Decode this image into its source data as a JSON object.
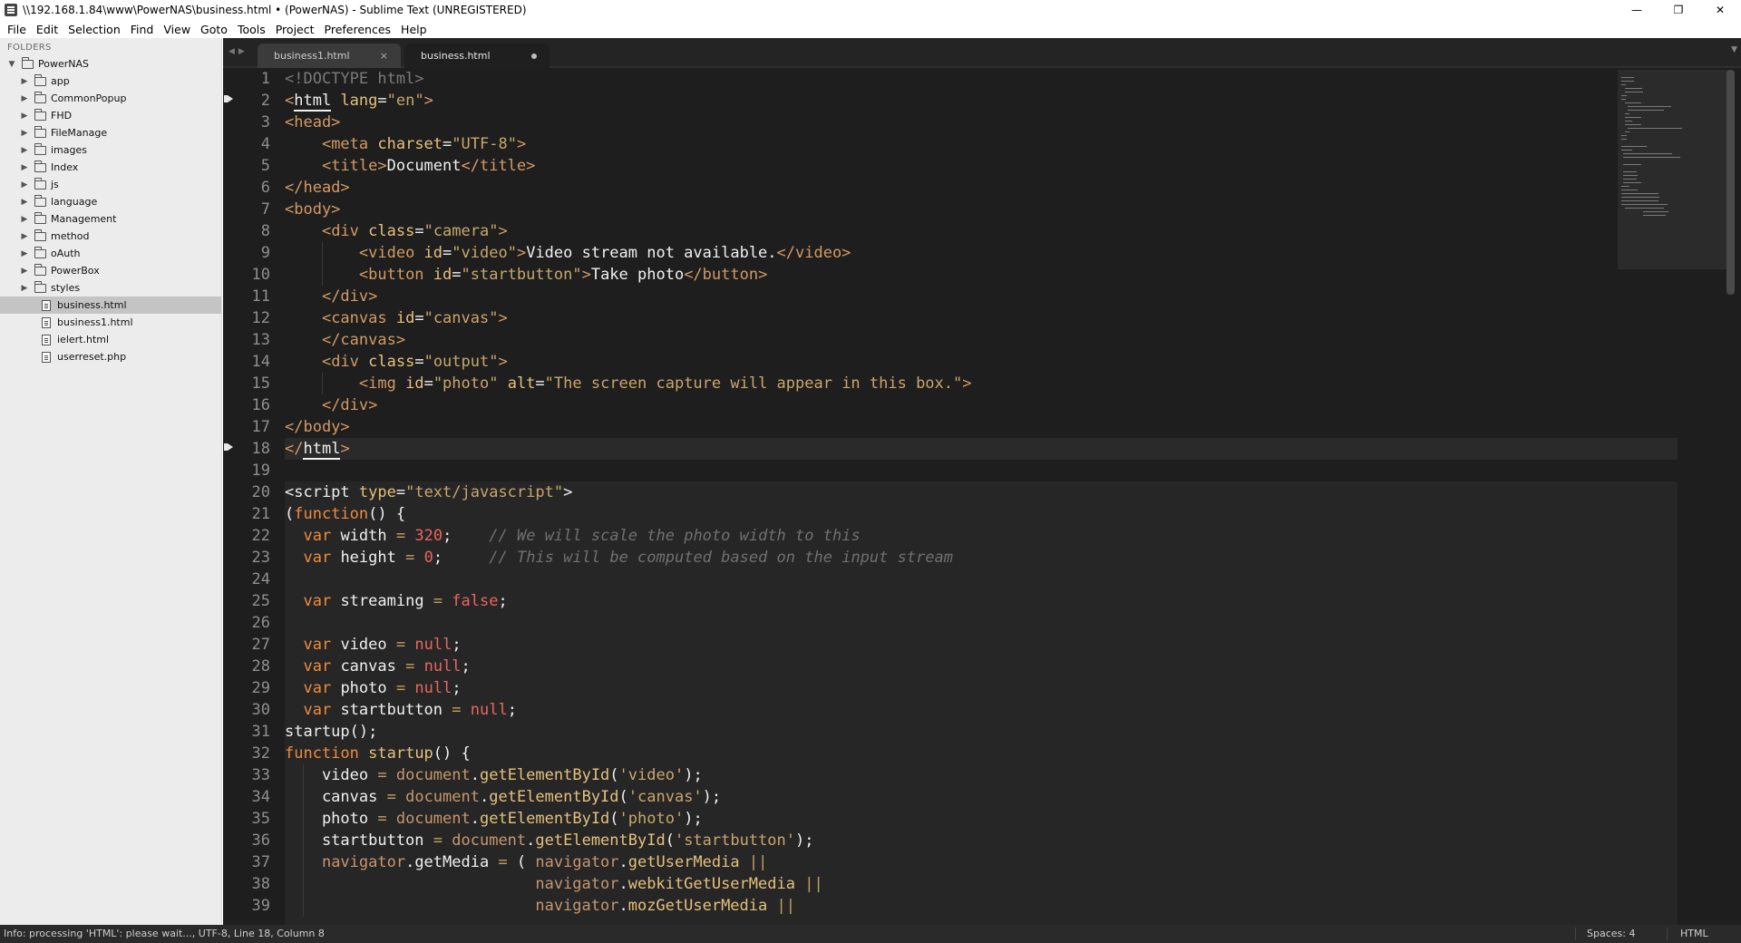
{
  "window": {
    "title": "\\\\192.168.1.84\\www\\PowerNAS\\business.html • (PowerNAS) - Sublime Text (UNREGISTERED)",
    "minimize": "—",
    "restore": "❐",
    "close": "✕"
  },
  "menu": [
    "File",
    "Edit",
    "Selection",
    "Find",
    "View",
    "Goto",
    "Tools",
    "Project",
    "Preferences",
    "Help"
  ],
  "sidebar": {
    "title": "FOLDERS",
    "root": "PowerNAS",
    "folders": [
      "app",
      "CommonPopup",
      "FHD",
      "FileManage",
      "images",
      "Index",
      "js",
      "language",
      "Management",
      "method",
      "oAuth",
      "PowerBox",
      "styles"
    ],
    "files": [
      "business.html",
      "business1.html",
      "ielert.html",
      "userreset.php"
    ],
    "selected_file": "business.html"
  },
  "tabs": [
    {
      "label": "business1.html",
      "close": "×",
      "state": "inactive"
    },
    {
      "label": "business.html",
      "state": "active",
      "modified": true
    }
  ],
  "icons": {
    "nav_left": "◀",
    "nav_right": "▶",
    "tab_dropdown": "▼",
    "expand": "▶",
    "collapse": "▼"
  },
  "editor": {
    "bookmarks": [
      2,
      18
    ],
    "current_line": 18,
    "lines": [
      [
        [
          "<!DOCTYPE html>",
          "doctype"
        ]
      ],
      [
        [
          "<",
          "tag"
        ],
        [
          "html",
          "match"
        ],
        [
          " lang",
          "attr"
        ],
        [
          "=",
          "punct"
        ],
        [
          "\"en\"",
          "string"
        ],
        [
          ">",
          "tag"
        ]
      ],
      [
        [
          "<head>",
          "tag"
        ]
      ],
      [
        [
          "    ",
          "default"
        ],
        [
          "<meta",
          "tag"
        ],
        [
          " charset",
          "attr"
        ],
        [
          "=",
          "punct"
        ],
        [
          "\"UTF-8\"",
          "string"
        ],
        [
          ">",
          "tag"
        ]
      ],
      [
        [
          "    ",
          "default"
        ],
        [
          "<title>",
          "tag"
        ],
        [
          "Document",
          "word"
        ],
        [
          "</title>",
          "tag"
        ]
      ],
      [
        [
          "</head>",
          "tag"
        ]
      ],
      [
        [
          "<body>",
          "tag"
        ]
      ],
      [
        [
          "    ",
          "default"
        ],
        [
          "<div",
          "tag"
        ],
        [
          " class",
          "attr"
        ],
        [
          "=",
          "punct"
        ],
        [
          "\"camera\"",
          "string"
        ],
        [
          ">",
          "tag"
        ]
      ],
      [
        [
          "        ",
          "default"
        ],
        [
          "<video",
          "tag"
        ],
        [
          " id",
          "attr"
        ],
        [
          "=",
          "punct"
        ],
        [
          "\"video\"",
          "string"
        ],
        [
          ">",
          "tag"
        ],
        [
          "Video stream not available.",
          "word"
        ],
        [
          "</video>",
          "tag"
        ]
      ],
      [
        [
          "        ",
          "default"
        ],
        [
          "<button",
          "tag"
        ],
        [
          " id",
          "attr"
        ],
        [
          "=",
          "punct"
        ],
        [
          "\"startbutton\"",
          "string"
        ],
        [
          ">",
          "tag"
        ],
        [
          "Take photo",
          "word"
        ],
        [
          "</button>",
          "tag"
        ]
      ],
      [
        [
          "    ",
          "default"
        ],
        [
          "</div>",
          "tag"
        ]
      ],
      [
        [
          "    ",
          "default"
        ],
        [
          "<canvas",
          "tag"
        ],
        [
          " id",
          "attr"
        ],
        [
          "=",
          "punct"
        ],
        [
          "\"canvas\"",
          "string"
        ],
        [
          ">",
          "tag"
        ]
      ],
      [
        [
          "    ",
          "default"
        ],
        [
          "</canvas>",
          "tag"
        ]
      ],
      [
        [
          "    ",
          "default"
        ],
        [
          "<div",
          "tag"
        ],
        [
          " class",
          "attr"
        ],
        [
          "=",
          "punct"
        ],
        [
          "\"output\"",
          "string"
        ],
        [
          ">",
          "tag"
        ]
      ],
      [
        [
          "        ",
          "default"
        ],
        [
          "<img",
          "tag"
        ],
        [
          " id",
          "attr"
        ],
        [
          "=",
          "punct"
        ],
        [
          "\"photo\"",
          "string"
        ],
        [
          " alt",
          "attr"
        ],
        [
          "=",
          "punct"
        ],
        [
          "\"The screen capture will appear in this box.\"",
          "string"
        ],
        [
          ">",
          "tag"
        ]
      ],
      [
        [
          "    ",
          "default"
        ],
        [
          "</div>",
          "tag"
        ]
      ],
      [
        [
          "</body>",
          "tag"
        ]
      ],
      [
        [
          "</",
          "tag"
        ],
        [
          "html",
          "match"
        ],
        [
          ">",
          "tag"
        ]
      ],
      [],
      [
        [
          "<script",
          "word"
        ],
        [
          " type",
          "attr"
        ],
        [
          "=",
          "punct"
        ],
        [
          "\"text/javascript\"",
          "string"
        ],
        [
          ">",
          "word"
        ]
      ],
      [
        [
          "(",
          "punct"
        ],
        [
          "function",
          "keyword"
        ],
        [
          "() {",
          "punct"
        ]
      ],
      [
        [
          "  ",
          "default"
        ],
        [
          "var",
          "keyword"
        ],
        [
          " width ",
          "word"
        ],
        [
          "=",
          "op"
        ],
        [
          " ",
          "default"
        ],
        [
          "320",
          "number"
        ],
        [
          ";",
          "punct"
        ],
        [
          "    ",
          "default"
        ],
        [
          "// We will scale the photo width to this",
          "comment"
        ]
      ],
      [
        [
          "  ",
          "default"
        ],
        [
          "var",
          "keyword"
        ],
        [
          " height ",
          "word"
        ],
        [
          "=",
          "op"
        ],
        [
          " ",
          "default"
        ],
        [
          "0",
          "number"
        ],
        [
          ";",
          "punct"
        ],
        [
          "     ",
          "default"
        ],
        [
          "// This will be computed based on the input stream",
          "comment"
        ]
      ],
      [],
      [
        [
          "  ",
          "default"
        ],
        [
          "var",
          "keyword"
        ],
        [
          " streaming ",
          "word"
        ],
        [
          "=",
          "op"
        ],
        [
          " ",
          "default"
        ],
        [
          "false",
          "const"
        ],
        [
          ";",
          "punct"
        ]
      ],
      [],
      [
        [
          "  ",
          "default"
        ],
        [
          "var",
          "keyword"
        ],
        [
          " video ",
          "word"
        ],
        [
          "=",
          "op"
        ],
        [
          " ",
          "default"
        ],
        [
          "null",
          "const"
        ],
        [
          ";",
          "punct"
        ]
      ],
      [
        [
          "  ",
          "default"
        ],
        [
          "var",
          "keyword"
        ],
        [
          " canvas ",
          "word"
        ],
        [
          "=",
          "op"
        ],
        [
          " ",
          "default"
        ],
        [
          "null",
          "const"
        ],
        [
          ";",
          "punct"
        ]
      ],
      [
        [
          "  ",
          "default"
        ],
        [
          "var",
          "keyword"
        ],
        [
          " photo ",
          "word"
        ],
        [
          "=",
          "op"
        ],
        [
          " ",
          "default"
        ],
        [
          "null",
          "const"
        ],
        [
          ";",
          "punct"
        ]
      ],
      [
        [
          "  ",
          "default"
        ],
        [
          "var",
          "keyword"
        ],
        [
          " startbutton ",
          "word"
        ],
        [
          "=",
          "op"
        ],
        [
          " ",
          "default"
        ],
        [
          "null",
          "const"
        ],
        [
          ";",
          "punct"
        ]
      ],
      [
        [
          "startup",
          "word"
        ],
        [
          "();",
          "punct"
        ]
      ],
      [
        [
          "function",
          "keyword"
        ],
        [
          " ",
          "default"
        ],
        [
          "startup",
          "func"
        ],
        [
          "() {",
          "punct"
        ]
      ],
      [
        [
          "    video ",
          "word"
        ],
        [
          "=",
          "op"
        ],
        [
          " ",
          "default"
        ],
        [
          "document",
          "builtin"
        ],
        [
          ".",
          "punct"
        ],
        [
          "getElementById",
          "func"
        ],
        [
          "(",
          "punct"
        ],
        [
          "'video'",
          "string"
        ],
        [
          ");",
          "punct"
        ]
      ],
      [
        [
          "    canvas ",
          "word"
        ],
        [
          "=",
          "op"
        ],
        [
          " ",
          "default"
        ],
        [
          "document",
          "builtin"
        ],
        [
          ".",
          "punct"
        ],
        [
          "getElementById",
          "func"
        ],
        [
          "(",
          "punct"
        ],
        [
          "'canvas'",
          "string"
        ],
        [
          ");",
          "punct"
        ]
      ],
      [
        [
          "    photo ",
          "word"
        ],
        [
          "=",
          "op"
        ],
        [
          " ",
          "default"
        ],
        [
          "document",
          "builtin"
        ],
        [
          ".",
          "punct"
        ],
        [
          "getElementById",
          "func"
        ],
        [
          "(",
          "punct"
        ],
        [
          "'photo'",
          "string"
        ],
        [
          ");",
          "punct"
        ]
      ],
      [
        [
          "    startbutton ",
          "word"
        ],
        [
          "=",
          "op"
        ],
        [
          " ",
          "default"
        ],
        [
          "document",
          "builtin"
        ],
        [
          ".",
          "punct"
        ],
        [
          "getElementById",
          "func"
        ],
        [
          "(",
          "punct"
        ],
        [
          "'startbutton'",
          "string"
        ],
        [
          ");",
          "punct"
        ]
      ],
      [
        [
          "    ",
          "default"
        ],
        [
          "navigator",
          "builtin"
        ],
        [
          ".getMedia ",
          "word"
        ],
        [
          "=",
          "op"
        ],
        [
          " ( ",
          "punct"
        ],
        [
          "navigator",
          "builtin"
        ],
        [
          ".",
          "punct"
        ],
        [
          "getUserMedia",
          "func"
        ],
        [
          " ",
          "default"
        ],
        [
          "||",
          "op"
        ]
      ],
      [
        [
          "                           ",
          "default"
        ],
        [
          "navigator",
          "builtin"
        ],
        [
          ".",
          "punct"
        ],
        [
          "webkitGetUserMedia",
          "func"
        ],
        [
          " ",
          "default"
        ],
        [
          "||",
          "op"
        ]
      ],
      [
        [
          "                           ",
          "default"
        ],
        [
          "navigator",
          "builtin"
        ],
        [
          ".",
          "punct"
        ],
        [
          "mozGetUserMedia",
          "func"
        ],
        [
          " ",
          "default"
        ],
        [
          "||",
          "op"
        ]
      ]
    ]
  },
  "status": {
    "text": "Info: processing 'HTML': please wait..., UTF-8, Line 18, Column 8",
    "spaces": "Spaces: 4",
    "syntax": "HTML"
  }
}
